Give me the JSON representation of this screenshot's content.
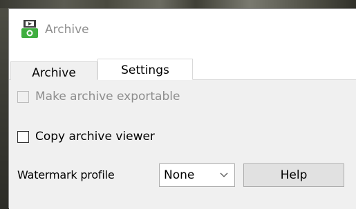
{
  "window": {
    "title": "Archive",
    "app_icon": "archive-app-icon"
  },
  "tabs": [
    {
      "label": "Archive",
      "active": false
    },
    {
      "label": "Settings",
      "active": true
    }
  ],
  "settings": {
    "exportable": {
      "label": "Make archive exportable",
      "checked": false,
      "enabled": false
    },
    "copy_viewer": {
      "label": "Copy archive viewer",
      "checked": false,
      "enabled": true
    },
    "watermark": {
      "label": "Watermark profile",
      "value": "None",
      "arrow_icon": "chevron-down-icon"
    },
    "help_label": "Help"
  },
  "colors": {
    "panel_bg": "#f0f0f0",
    "title_text": "#8c8c8c",
    "disabled_text": "#8d8d8d",
    "icon_green": "#3fae3f"
  }
}
